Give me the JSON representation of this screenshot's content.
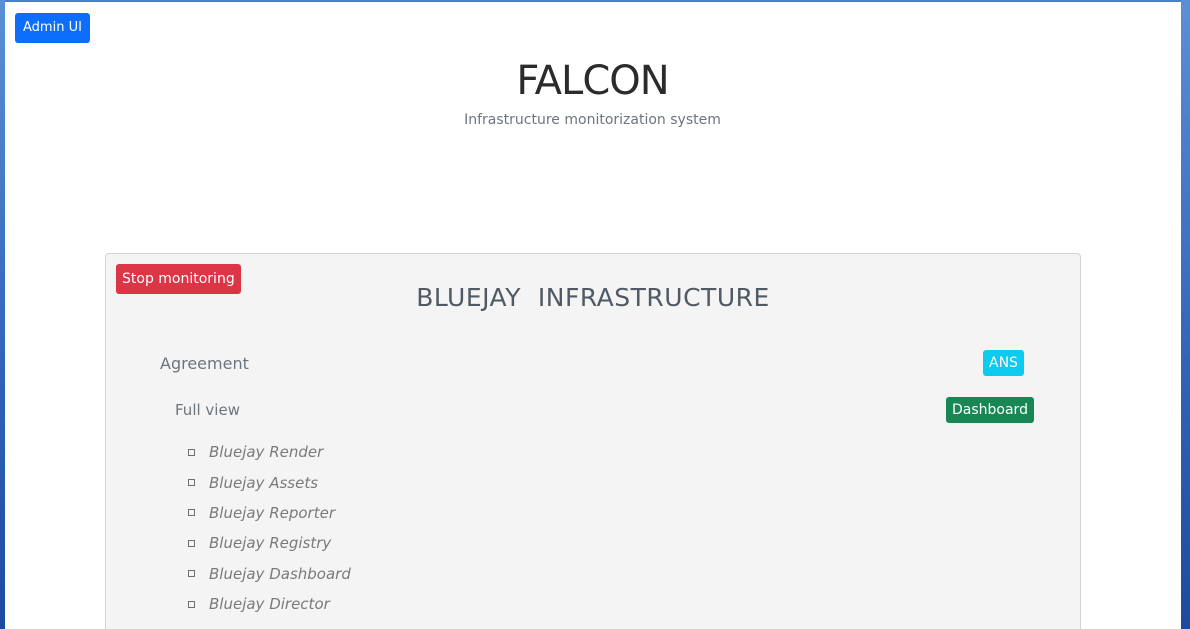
{
  "header": {
    "admin_button": "Admin UI",
    "title": "FALCON",
    "subtitle": "Infrastructure monitorization system"
  },
  "infrastructure": {
    "stop_button": "Stop monitoring",
    "title": "BLUEJAY  INFRASTRUCTURE",
    "agreement_label": "Agreement",
    "ans_badge": "ANS",
    "full_view_label": "Full view",
    "dashboard_button": "Dashboard",
    "services": [
      "Bluejay Render",
      "Bluejay Assets",
      "Bluejay Reporter",
      "Bluejay Registry",
      "Bluejay Dashboard",
      "Bluejay Director"
    ]
  },
  "colors": {
    "primary": "#0d6efd",
    "danger": "#dc3545",
    "info": "#0dcaf0",
    "success": "#198754",
    "card_background": "#f4f4f4"
  }
}
